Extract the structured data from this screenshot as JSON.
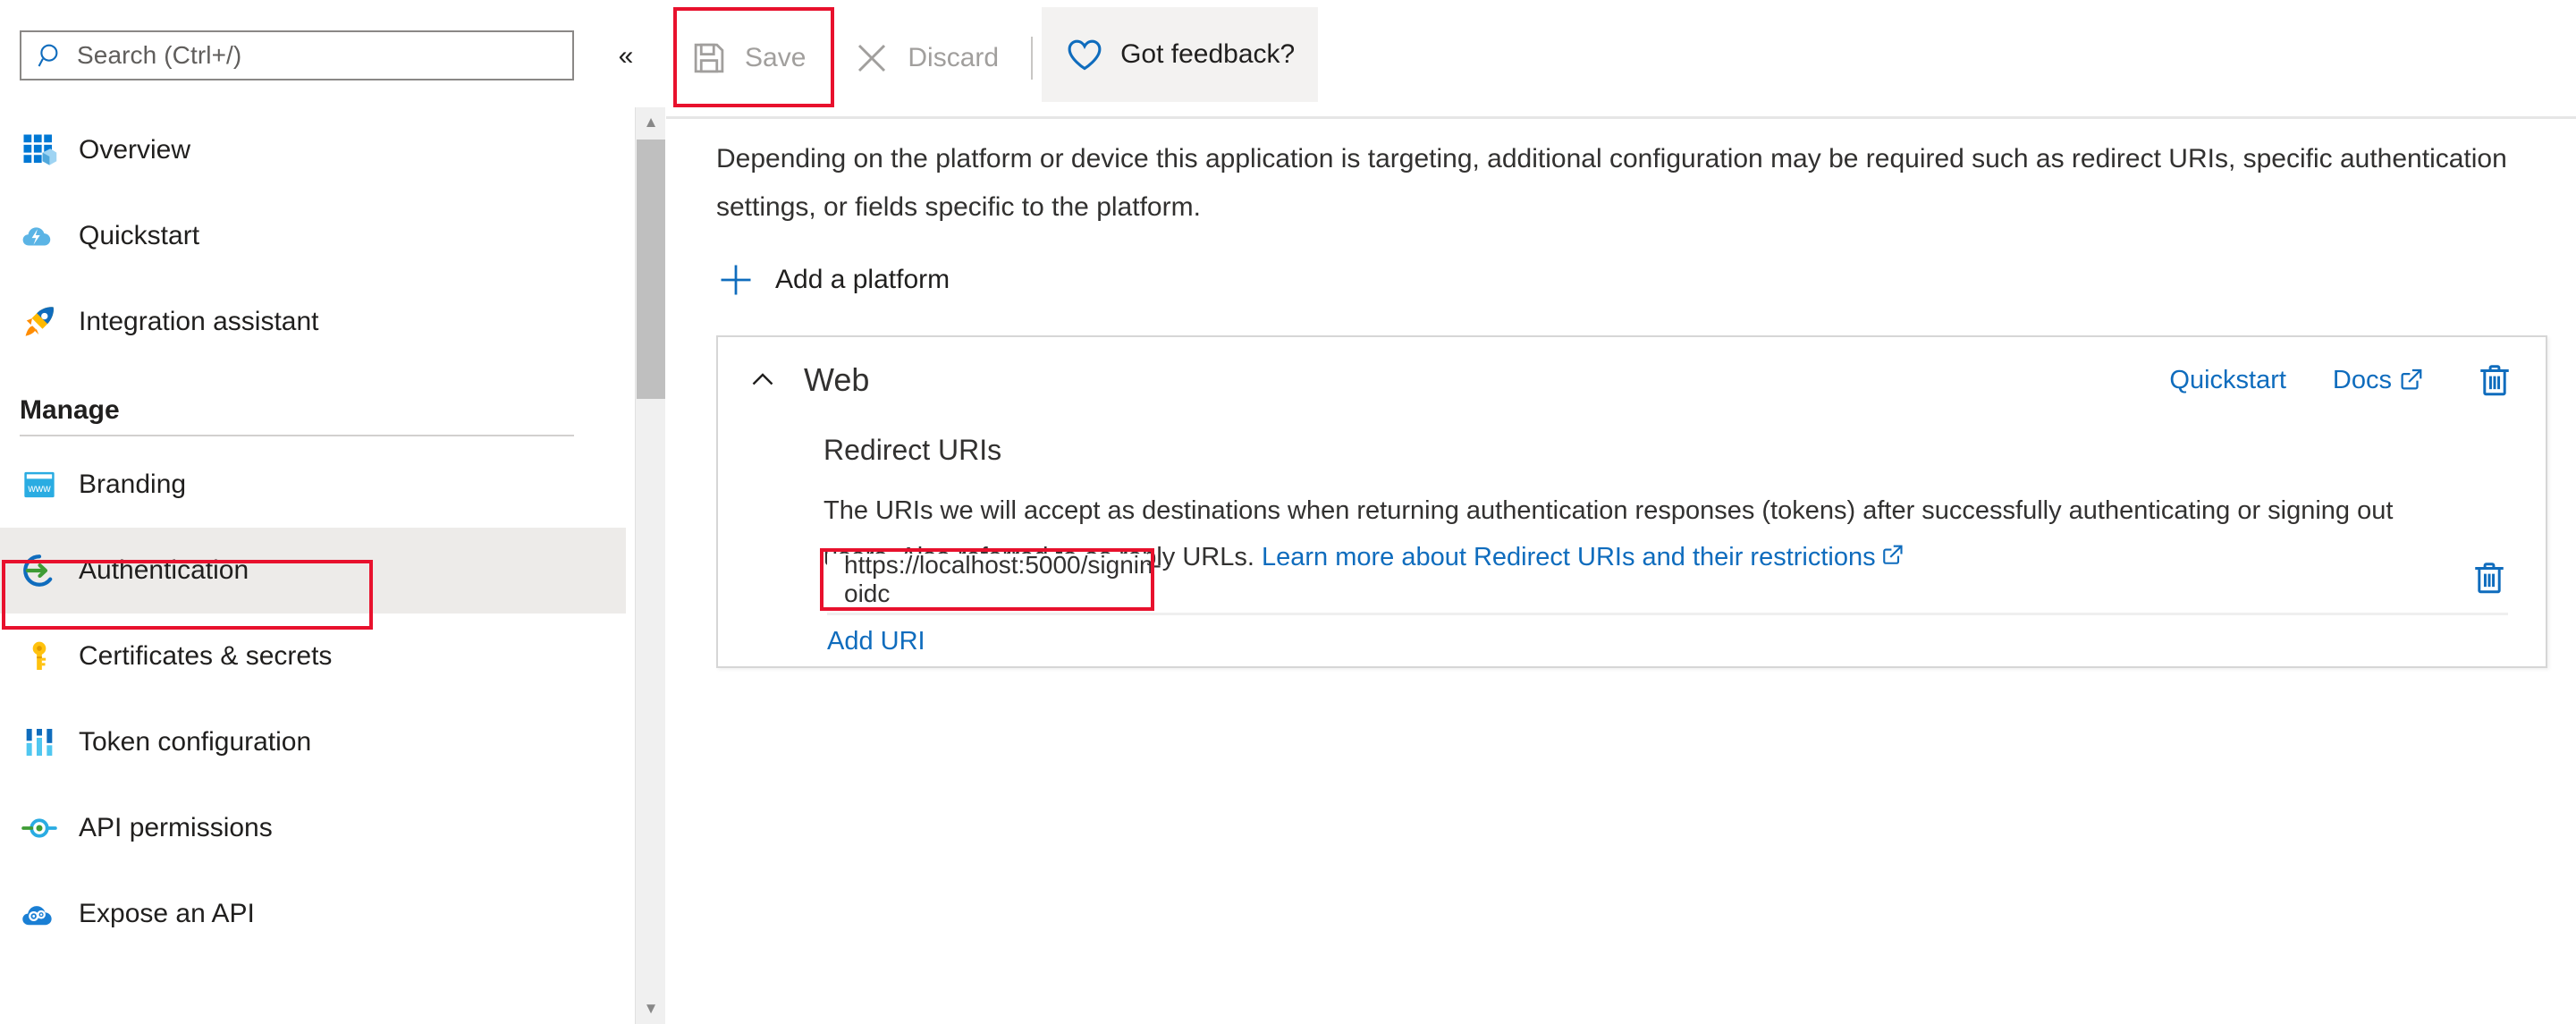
{
  "sidebar": {
    "search": {
      "placeholder": "Search (Ctrl+/)",
      "value": "",
      "icon": "search-icon"
    },
    "collapse_label": "«",
    "items": [
      {
        "label": "Overview",
        "icon": "overview-grid-icon",
        "selected": false
      },
      {
        "label": "Quickstart",
        "icon": "cloud-lightning-icon",
        "selected": false
      },
      {
        "label": "Integration assistant",
        "icon": "rocket-icon",
        "selected": false
      }
    ],
    "group": {
      "title": "Manage",
      "items": [
        {
          "label": "Branding",
          "icon": "browser-www-icon",
          "selected": false
        },
        {
          "label": "Authentication",
          "icon": "authentication-arrow-icon",
          "selected": true
        },
        {
          "label": "Certificates & secrets",
          "icon": "key-icon",
          "selected": false
        },
        {
          "label": "Token configuration",
          "icon": "sliders-icon",
          "selected": false
        },
        {
          "label": "API permissions",
          "icon": "api-connector-icon",
          "selected": false
        },
        {
          "label": "Expose an API",
          "icon": "cloud-gears-icon",
          "selected": false
        }
      ]
    }
  },
  "commandbar": {
    "save": {
      "label": "Save",
      "icon": "save-floppy-icon",
      "disabled": true
    },
    "discard": {
      "label": "Discard",
      "icon": "close-x-icon",
      "disabled": true
    },
    "feedback": {
      "label": "Got feedback?",
      "icon": "heart-icon",
      "disabled": false
    }
  },
  "main": {
    "intro": "Depending on the platform or device this application is targeting, additional configuration may be required such as redirect URIs, specific authentication settings, or fields specific to the platform.",
    "add_platform": {
      "label": "Add a platform",
      "icon": "plus-icon"
    }
  },
  "platform_card": {
    "title": "Web",
    "collapse_icon": "chevron-up-icon",
    "quickstart_label": "Quickstart",
    "docs_label": "Docs",
    "docs_icon": "external-link-icon",
    "delete_icon": "trash-icon",
    "section": {
      "title": "Redirect URIs",
      "description_part1": "The URIs we will accept as destinations when returning authentication responses (tokens) after successfully authenticating or signing out users. Also referred to as reply URLs. ",
      "link_text": "Learn more about Redirect URIs and their restrictions",
      "link_icon": "external-link-icon"
    },
    "uris": [
      {
        "value": "https://localhost:5000/signin-oidc",
        "delete_icon": "trash-icon"
      }
    ],
    "add_uri_label": "Add URI"
  },
  "annotations": {
    "highlight_color": "#e8112d",
    "boxes": [
      "save-button",
      "sidebar-item-authentication",
      "redirect-uri-input"
    ]
  },
  "scrollbar": {
    "up_arrow": "▲",
    "down_arrow": "▼"
  },
  "colors": {
    "accent_link": "#0f6cbd",
    "selected_bg": "#edebe9",
    "feedback_bg": "#f3f2f1",
    "disabled_text": "#a19f9d"
  }
}
